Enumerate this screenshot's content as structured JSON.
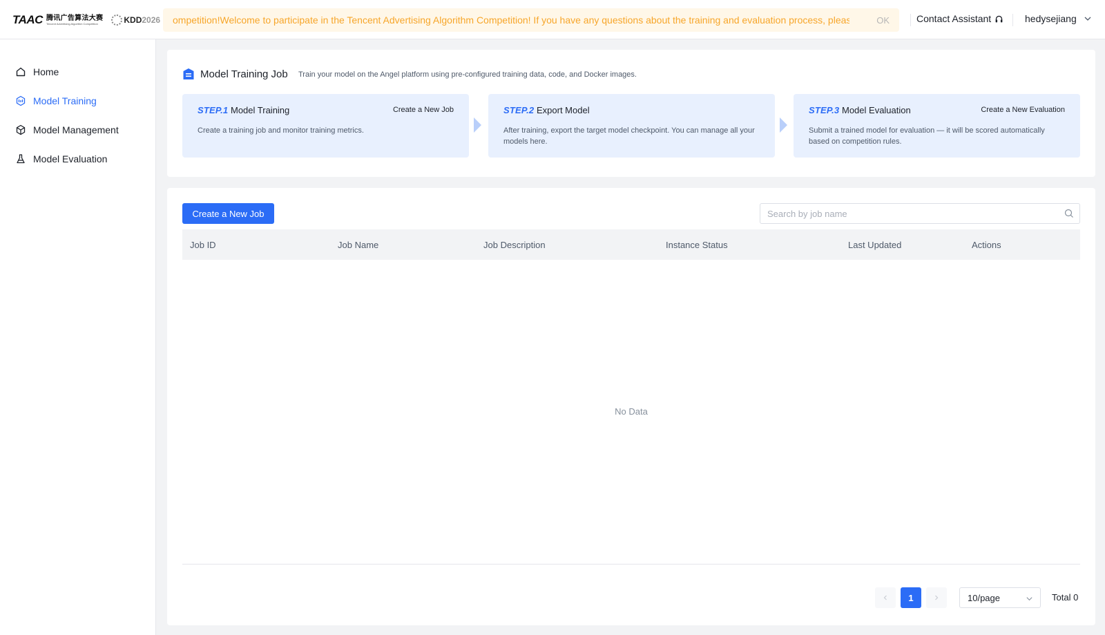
{
  "header": {
    "logo": {
      "brand": "TAAC",
      "cn_name": "腾讯广告算法大赛",
      "cn_sub": "Tencent Advertising Algorithm Competition",
      "kdd_mark": "KDD",
      "kdd_year": "2026"
    },
    "notice": {
      "text": "ompetition!Welcome to participate in the Tencent Advertising Algorithm Competition! If you have any questions about the training and evaluation process, please refer to the documentation.",
      "ok_label": "OK"
    },
    "contact_label": "Contact Assistant",
    "username": "hedysejiang"
  },
  "sidebar": {
    "items": [
      {
        "label": "Home",
        "icon": "home-icon",
        "active": false
      },
      {
        "label": "Model Training",
        "icon": "training-icon",
        "active": true
      },
      {
        "label": "Model Management",
        "icon": "cube-icon",
        "active": false
      },
      {
        "label": "Model Evaluation",
        "icon": "flask-icon",
        "active": false
      }
    ]
  },
  "intro": {
    "title": "Model Training Job",
    "description": "Train your model on the Angel platform using pre-configured training data, code, and Docker images.",
    "steps": [
      {
        "tag": "STEP.1",
        "title": "Model Training",
        "link": "Create a New Job",
        "desc": "Create a training job and monitor training metrics."
      },
      {
        "tag": "STEP.2",
        "title": "Export Model",
        "link": "",
        "desc": "After training, export the target model checkpoint. You can manage all your models here."
      },
      {
        "tag": "STEP.3",
        "title": "Model Evaluation",
        "link": "Create a New Evaluation",
        "desc": "Submit a trained model for evaluation — it will be scored automatically based on competition rules."
      }
    ]
  },
  "jobs": {
    "create_button": "Create a New Job",
    "search_placeholder": "Search by job name",
    "columns": [
      "Job ID",
      "Job Name",
      "Job Description",
      "Instance Status",
      "Last Updated",
      "Actions"
    ],
    "empty_text": "No Data",
    "pagination": {
      "current_page": "1",
      "page_size": "10/page",
      "total": "Total 0"
    }
  },
  "colors": {
    "primary": "#2b6cf6",
    "notice_text": "#f7a62a",
    "notice_bg": "#fff7e8",
    "step_bg": "#e8f0fe"
  }
}
